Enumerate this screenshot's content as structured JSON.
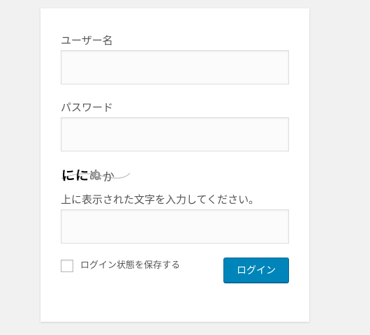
{
  "login_form": {
    "username_label": "ユーザー名",
    "username_value": "",
    "password_label": "パスワード",
    "password_value": "",
    "captcha": {
      "image_text": "ににぬか",
      "instruction": "上に表示された文字を入力してください。",
      "value": ""
    },
    "remember_label": "ログイン状態を保存する",
    "remember_checked": false,
    "submit_label": "ログイン"
  },
  "colors": {
    "page_background": "#f1f1f1",
    "card_background": "#ffffff",
    "button_background": "#0085ba",
    "button_text": "#ffffff"
  }
}
